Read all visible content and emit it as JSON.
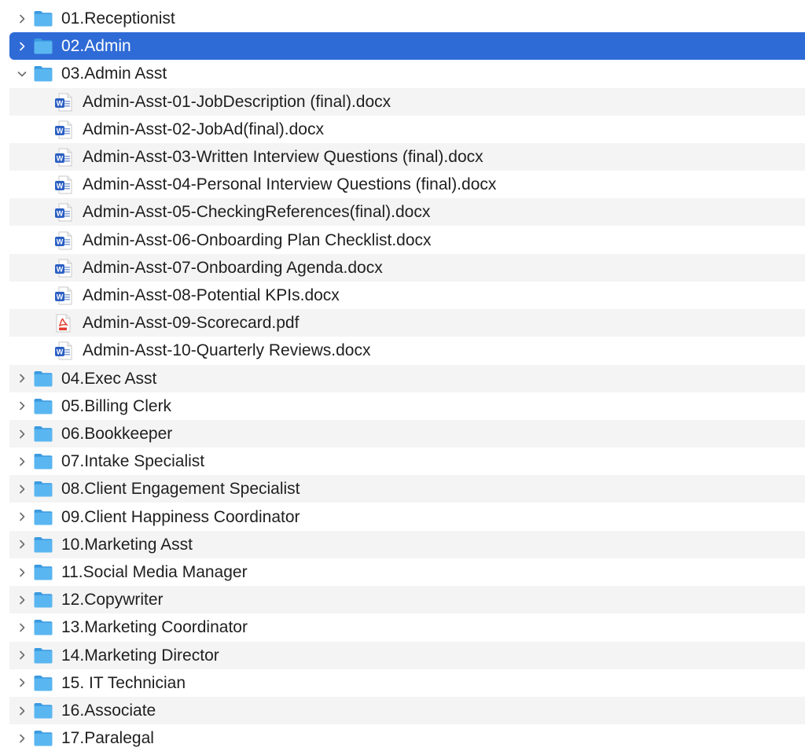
{
  "colors": {
    "selection": "#2f6bd6",
    "folder_blue": "#5ab6f0",
    "folder_blue_dark": "#3b9ae0",
    "word_blue": "#2b5fc3",
    "pdf_red": "#e23b2e"
  },
  "rows": [
    {
      "kind": "folder",
      "name": "01.Receptionist",
      "expanded": false,
      "selected": false
    },
    {
      "kind": "folder",
      "name": "02.Admin",
      "expanded": false,
      "selected": true
    },
    {
      "kind": "folder",
      "name": "03.Admin Asst",
      "expanded": true,
      "selected": false
    },
    {
      "kind": "file",
      "icon": "word-doc-icon",
      "name": "Admin-Asst-01-JobDescription (final).docx"
    },
    {
      "kind": "file",
      "icon": "word-doc-icon",
      "name": "Admin-Asst-02-JobAd(final).docx"
    },
    {
      "kind": "file",
      "icon": "word-doc-icon",
      "name": "Admin-Asst-03-Written Interview Questions (final).docx"
    },
    {
      "kind": "file",
      "icon": "word-doc-icon",
      "name": "Admin-Asst-04-Personal Interview Questions (final).docx"
    },
    {
      "kind": "file",
      "icon": "word-doc-icon",
      "name": "Admin-Asst-05-CheckingReferences(final).docx"
    },
    {
      "kind": "file",
      "icon": "word-doc-icon",
      "name": "Admin-Asst-06-Onboarding Plan Checklist.docx"
    },
    {
      "kind": "file",
      "icon": "word-doc-icon",
      "name": "Admin-Asst-07-Onboarding Agenda.docx"
    },
    {
      "kind": "file",
      "icon": "word-doc-icon",
      "name": "Admin-Asst-08-Potential KPIs.docx"
    },
    {
      "kind": "file",
      "icon": "pdf-icon",
      "name": "Admin-Asst-09-Scorecard.pdf"
    },
    {
      "kind": "file",
      "icon": "word-doc-icon",
      "name": "Admin-Asst-10-Quarterly Reviews.docx"
    },
    {
      "kind": "folder",
      "name": "04.Exec Asst",
      "expanded": false,
      "selected": false
    },
    {
      "kind": "folder",
      "name": "05.Billing Clerk",
      "expanded": false,
      "selected": false
    },
    {
      "kind": "folder",
      "name": "06.Bookkeeper",
      "expanded": false,
      "selected": false
    },
    {
      "kind": "folder",
      "name": "07.Intake Specialist",
      "expanded": false,
      "selected": false
    },
    {
      "kind": "folder",
      "name": "08.Client Engagement Specialist",
      "expanded": false,
      "selected": false
    },
    {
      "kind": "folder",
      "name": "09.Client Happiness Coordinator",
      "expanded": false,
      "selected": false
    },
    {
      "kind": "folder",
      "name": "10.Marketing Asst",
      "expanded": false,
      "selected": false
    },
    {
      "kind": "folder",
      "name": "11.Social Media Manager",
      "expanded": false,
      "selected": false
    },
    {
      "kind": "folder",
      "name": "12.Copywriter",
      "expanded": false,
      "selected": false
    },
    {
      "kind": "folder",
      "name": "13.Marketing Coordinator",
      "expanded": false,
      "selected": false
    },
    {
      "kind": "folder",
      "name": "14.Marketing Director",
      "expanded": false,
      "selected": false
    },
    {
      "kind": "folder",
      "name": "15. IT Technician",
      "expanded": false,
      "selected": false
    },
    {
      "kind": "folder",
      "name": "16.Associate",
      "expanded": false,
      "selected": false
    },
    {
      "kind": "folder",
      "name": "17.Paralegal",
      "expanded": false,
      "selected": false
    }
  ]
}
